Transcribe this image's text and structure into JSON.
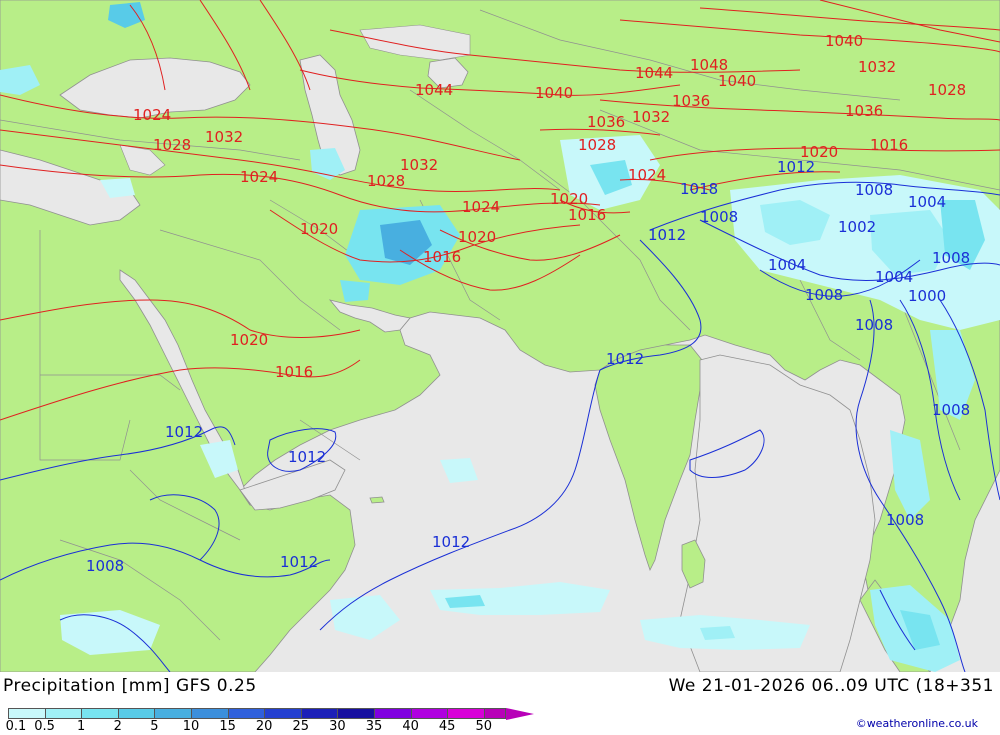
{
  "title": {
    "left": "Precipitation [mm] GFS 0.25",
    "right": "We 21-01-2026 06..09 UTC (18+351"
  },
  "legend": {
    "values": [
      "0.1",
      "0.5",
      "1",
      "2",
      "5",
      "10",
      "15",
      "20",
      "25",
      "30",
      "35",
      "40",
      "45",
      "50"
    ],
    "colors": [
      "#c8f8fa",
      "#a0f0f6",
      "#78e4f0",
      "#58cbe8",
      "#48afe0",
      "#3c8fdc",
      "#3060dc",
      "#2440d0",
      "#1c20b8",
      "#1810a0",
      "#8000e0",
      "#b000e0",
      "#d800d8",
      "#b800b8"
    ]
  },
  "copyright": "©weatheronline.co.uk",
  "colors": {
    "land": "#b8ee88",
    "sea": "#e8e8e8",
    "high_pressure_isobar": "#e02020",
    "low_pressure_isobar": "#1a2fd6",
    "borders": "#909090"
  },
  "isobar_labels": {
    "red": [
      "1024",
      "1028",
      "1032",
      "1044",
      "1040",
      "1044",
      "1048",
      "1040",
      "1040",
      "1032",
      "1028",
      "1036",
      "1036",
      "1032",
      "1036",
      "1028",
      "1032",
      "1028",
      "1024",
      "1024",
      "1020",
      "1024",
      "1020",
      "1016",
      "1020",
      "1016",
      "1020",
      "1016",
      "1020",
      "1016"
    ],
    "blue": [
      "1012",
      "1018",
      "1008",
      "1004",
      "1008",
      "1002",
      "1012",
      "1004",
      "1004",
      "1008",
      "1008",
      "1000",
      "1008",
      "1012",
      "1008",
      "1012",
      "1012",
      "1008",
      "1012",
      "1012",
      "1008"
    ]
  }
}
